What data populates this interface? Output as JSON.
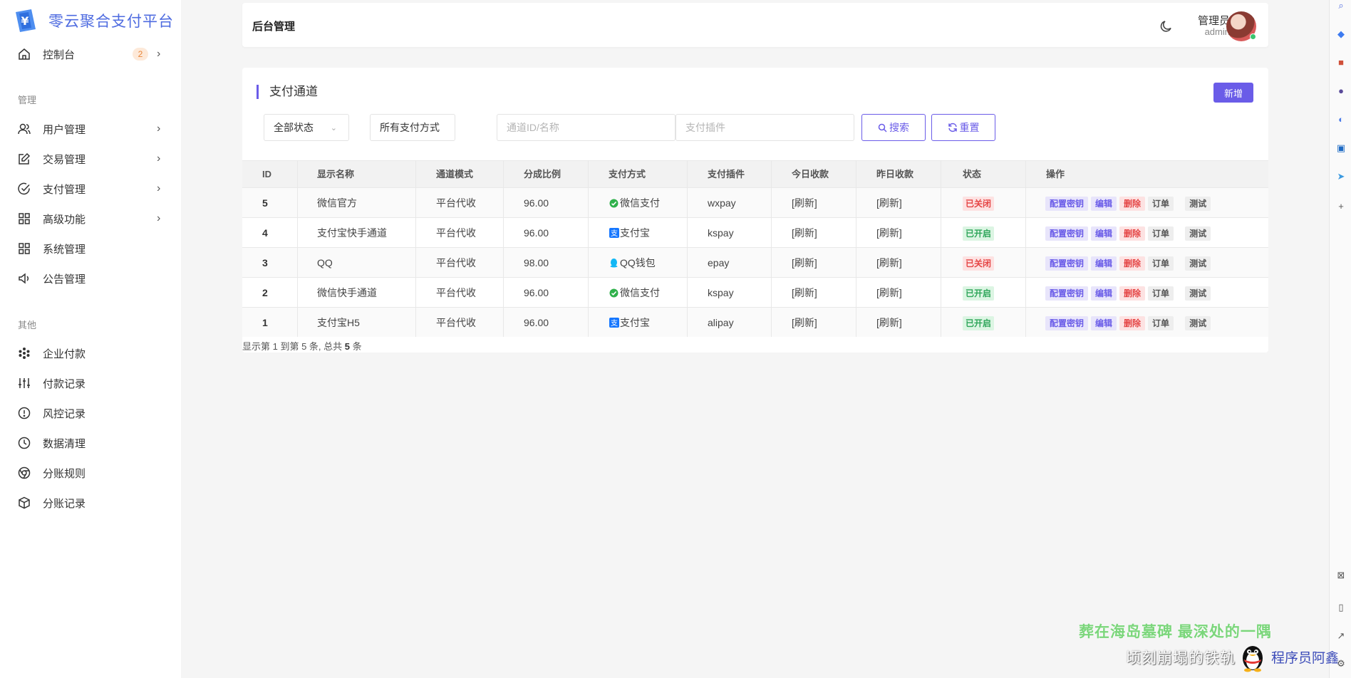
{
  "brand": {
    "name": "零云聚合支付平台",
    "logo_symbol": "¥",
    "accent": "#4e6be0"
  },
  "sidebar": {
    "dashboard": {
      "label": "控制台",
      "badge": "2"
    },
    "section_manage": "管理",
    "manage_items": [
      {
        "label": "用户管理",
        "icon": "user-icon",
        "chevron": true
      },
      {
        "label": "交易管理",
        "icon": "edit-icon",
        "chevron": true
      },
      {
        "label": "支付管理",
        "icon": "check-circle-icon",
        "chevron": true
      },
      {
        "label": "高级功能",
        "icon": "grid-icon",
        "chevron": true
      },
      {
        "label": "系统管理",
        "icon": "grid-icon",
        "chevron": false
      },
      {
        "label": "公告管理",
        "icon": "speaker-icon",
        "chevron": false
      }
    ],
    "section_other": "其他",
    "other_items": [
      {
        "label": "企业付款",
        "icon": "cluster-icon"
      },
      {
        "label": "付款记录",
        "icon": "sliders-icon"
      },
      {
        "label": "风控记录",
        "icon": "alert-icon"
      },
      {
        "label": "数据清理",
        "icon": "clock-icon"
      },
      {
        "label": "分账规则",
        "icon": "chrome-icon"
      },
      {
        "label": "分账记录",
        "icon": "box-icon"
      }
    ]
  },
  "topbar": {
    "title": "后台管理",
    "user_name": "管理员",
    "user_role": "admin"
  },
  "panel": {
    "title": "支付通道",
    "add_label": "新增",
    "filters": {
      "status_value": "全部状态",
      "method_value": "所有支付方式",
      "channel_placeholder": "通道ID/名称",
      "plugin_placeholder": "支付插件"
    },
    "search_label": "搜索",
    "reset_label": "重置"
  },
  "table": {
    "headers": [
      "ID",
      "显示名称",
      "通道模式",
      "分成比例",
      "支付方式",
      "支付插件",
      "今日收款",
      "昨日收款",
      "状态",
      "操作"
    ],
    "rows": [
      {
        "id": "5",
        "name": "微信官方",
        "mode": "平台代收",
        "rate": "96.00",
        "method": "微信支付",
        "method_icon": "wechat-icon",
        "plugin": "wxpay",
        "today": "[刷新]",
        "yesterday": "[刷新]",
        "status": "已关闭",
        "status_on": false
      },
      {
        "id": "4",
        "name": "支付宝快手通道",
        "mode": "平台代收",
        "rate": "96.00",
        "method": "支付宝",
        "method_icon": "alipay-icon",
        "plugin": "kspay",
        "today": "[刷新]",
        "yesterday": "[刷新]",
        "status": "已开启",
        "status_on": true
      },
      {
        "id": "3",
        "name": "QQ",
        "mode": "平台代收",
        "rate": "98.00",
        "method": "QQ钱包",
        "method_icon": "qq-icon",
        "plugin": "epay",
        "today": "[刷新]",
        "yesterday": "[刷新]",
        "status": "已关闭",
        "status_on": false
      },
      {
        "id": "2",
        "name": "微信快手通道",
        "mode": "平台代收",
        "rate": "96.00",
        "method": "微信支付",
        "method_icon": "wechat-icon",
        "plugin": "kspay",
        "today": "[刷新]",
        "yesterday": "[刷新]",
        "status": "已开启",
        "status_on": true
      },
      {
        "id": "1",
        "name": "支付宝H5",
        "mode": "平台代收",
        "rate": "96.00",
        "method": "支付宝",
        "method_icon": "alipay-icon",
        "plugin": "alipay",
        "today": "[刷新]",
        "yesterday": "[刷新]",
        "status": "已开启",
        "status_on": true
      }
    ],
    "actions": {
      "key": "配置密钥",
      "edit": "编辑",
      "delete": "删除",
      "orders": "订单",
      "test": "测试"
    },
    "summary": {
      "prefix": "显示第 1 到第 5 条, 总共 ",
      "total": "5",
      "suffix": " 条"
    }
  },
  "overlay": {
    "line1": "葬在海岛墓碑 最深处的一隅",
    "line2": "顷刻崩塌的铁轨",
    "channel_name": "程序员阿鑫"
  },
  "colors": {
    "primary": "#6a5ce8",
    "danger": "#e54545",
    "success": "#2fa65a"
  }
}
